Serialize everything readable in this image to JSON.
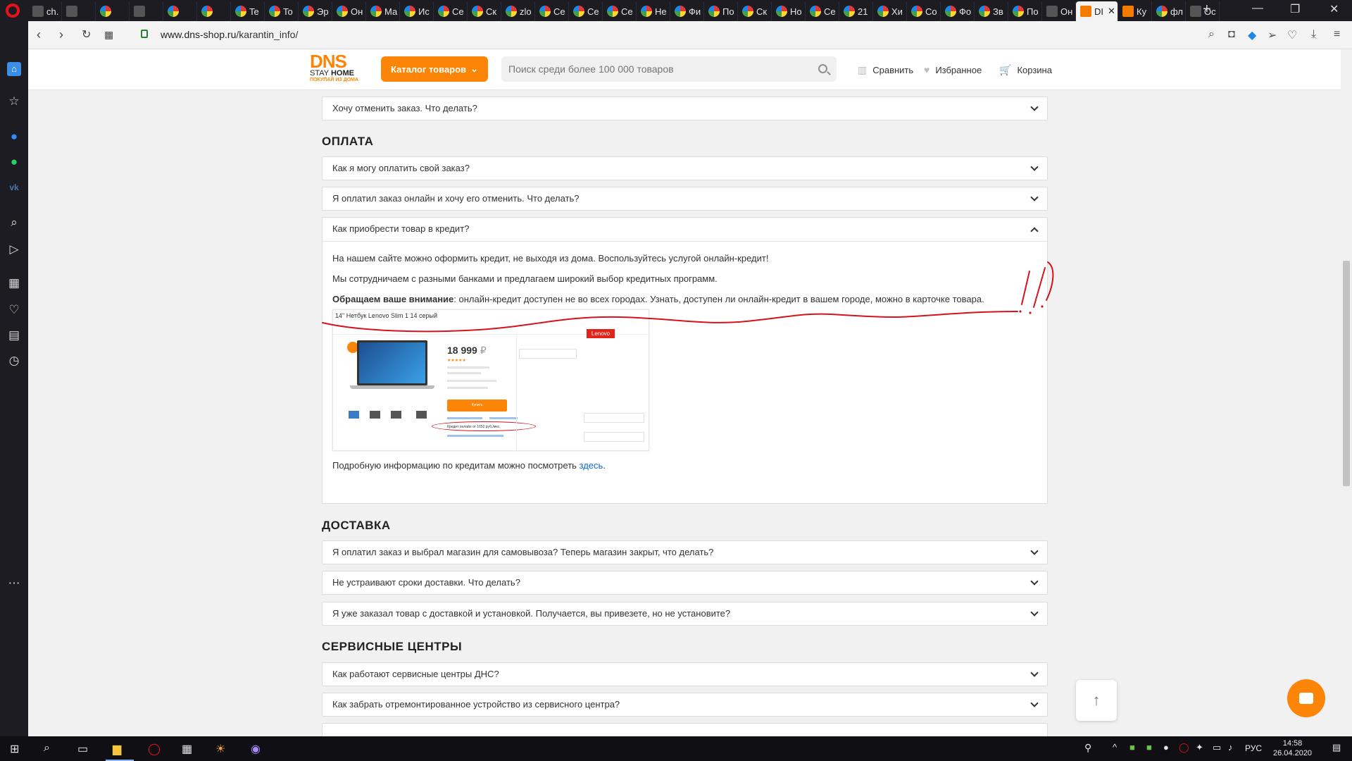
{
  "browser": {
    "tabs": [
      {
        "label": "ch.",
        "icon": "page-icon"
      },
      {
        "label": "",
        "icon": "youtube-icon"
      },
      {
        "label": "",
        "icon": "vk-icon"
      },
      {
        "label": "",
        "icon": "calendar-icon"
      },
      {
        "label": "",
        "icon": "drive-icon"
      },
      {
        "label": "",
        "icon": "red-icon"
      },
      {
        "label": "Te",
        "icon": "red-icon"
      },
      {
        "label": "To",
        "icon": "multicolor-icon"
      },
      {
        "label": "Эр",
        "icon": "multicolor-icon"
      },
      {
        "label": "Он",
        "icon": "multicolor-icon"
      },
      {
        "label": "Ма",
        "icon": "multicolor-icon"
      },
      {
        "label": "Ис",
        "icon": "multicolor-icon"
      },
      {
        "label": "Се",
        "icon": "multicolor-icon"
      },
      {
        "label": "Ск",
        "icon": "multicolor-icon"
      },
      {
        "label": "zlo",
        "icon": "multicolor-icon"
      },
      {
        "label": "Се",
        "icon": "multicolor-icon"
      },
      {
        "label": "Се",
        "icon": "multicolor-icon"
      },
      {
        "label": "Се",
        "icon": "multicolor-icon"
      },
      {
        "label": "Не",
        "icon": "multicolor-icon"
      },
      {
        "label": "Фи",
        "icon": "multicolor-icon"
      },
      {
        "label": "По",
        "icon": "multicolor-icon"
      },
      {
        "label": "Ск",
        "icon": "multicolor-icon"
      },
      {
        "label": "Но",
        "icon": "multicolor-icon"
      },
      {
        "label": "Се",
        "icon": "multicolor-icon"
      },
      {
        "label": "21",
        "icon": "multicolor-icon"
      },
      {
        "label": "Хи",
        "icon": "multicolor-icon"
      },
      {
        "label": "Со",
        "icon": "multicolor-icon"
      },
      {
        "label": "Фо",
        "icon": "multicolor-icon"
      },
      {
        "label": "Зв",
        "icon": "multicolor-icon"
      },
      {
        "label": "По",
        "icon": "multicolor-icon"
      },
      {
        "label": "Он",
        "icon": "page-icon"
      },
      {
        "label": "DI",
        "icon": "dns-icon",
        "active": true
      },
      {
        "label": "Ку",
        "icon": "dns-icon"
      },
      {
        "label": "фл",
        "icon": "google-icon"
      },
      {
        "label": "Ос",
        "icon": "form-icon"
      }
    ],
    "url_host": "www.dns-shop.ru",
    "url_path": "/karantin_info/"
  },
  "site": {
    "logo_text": "DNS",
    "logo_stay": "STAY ",
    "logo_home": "HOME",
    "logo_sub": "ПОКУПАЙ ИЗ ДОМА",
    "catalog_label": "Каталог товаров",
    "search_placeholder": "Поиск среди более 100 000 товаров",
    "compare_label": "Сравнить",
    "favorites_label": "Избранное",
    "cart_label": "Корзина"
  },
  "faq": {
    "top_item": "Хочу отменить заказ. Что делать?",
    "payment": {
      "title": "ОПЛАТА",
      "items": [
        "Как я могу оплатить свой заказ?",
        "Я оплатил заказ онлайн и хочу его отменить. Что делать?"
      ],
      "open_question": "Как приобрести товар в кредит?",
      "p1": "На нашем сайте можно оформить кредит, не выходя из дома. Воспользуйтесь услугой онлайн-кредит!",
      "p2": "Мы сотрудничаем с разными банками и предлагаем широкий выбор кредитных программ.",
      "p3_bold": "Обращаем ваше внимание",
      "p3_rest": ": онлайн-кредит доступен не во всех городах.  Узнать, доступен ли онлайн-кредит в вашем городе, можно в карточке товара.",
      "p4_before": "Подробную информацию по кредитам можно посмотреть ",
      "p4_link": "здесь",
      "p4_after": "."
    },
    "delivery": {
      "title": "ДОСТАВКА",
      "items": [
        "Я оплатил заказ и выбрал магазин для самовывоза? Теперь магазин закрыт, что делать?",
        "Не устраивают сроки доставки. Что делать?",
        "Я уже заказал товар с доставкой и установкой. Получается, вы привезете, но не установите?"
      ]
    },
    "service": {
      "title": "СЕРВИСНЫЕ ЦЕНТРЫ",
      "items": [
        "Как работают сервисные центры ДНС?",
        "Как забрать отремонтированное устройство из сервисного центра?"
      ]
    }
  },
  "product_card": {
    "title": "14\" Нетбук Lenovo Slim 1 14 серый",
    "price": "18 999",
    "currency": "₽",
    "buy_label": "Купить",
    "credit_text": "Кредит онлайн от 1652 руб./мес.",
    "brand": "Lenovo"
  },
  "annotation": {
    "marks": "!!!",
    "color": "#d6131b"
  },
  "colors": {
    "brand_orange": "#fc8507",
    "link_blue": "#0b6bd6"
  },
  "taskbar": {
    "lang": "РУС",
    "time": "14:58",
    "date": "26.04.2020"
  }
}
